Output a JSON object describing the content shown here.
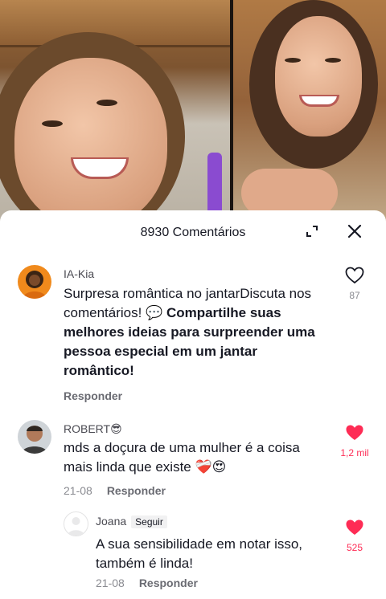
{
  "sheet": {
    "title": "8930 Comentários",
    "expand_icon": "expand-icon",
    "close_icon": "close-icon"
  },
  "comments": [
    {
      "username": "IA-Kia",
      "text_plain": "Surpresa romântica no jantarDiscuta nos comentários! ",
      "emoji": "💬",
      "text_bold": " Compartilhe suas melhores ideias para surpreender uma pessoa especial em um jantar romântico!",
      "reply_label": "Responder",
      "likes": "87",
      "liked": false
    },
    {
      "username": "ROBERT😎",
      "text": "mds a doçura de uma mulher é a coisa mais linda que existe ❤️‍🩹😍",
      "date": "21-08",
      "reply_label": "Responder",
      "likes": "1,2 mil",
      "liked": true
    },
    {
      "username": "Joana",
      "follow_label": "Seguir",
      "text": "A sua sensibilidade em notar isso, também é linda!",
      "date": "21-08",
      "reply_label": "Responder",
      "likes": "525",
      "liked": true
    }
  ],
  "colors": {
    "like_active": "#fe2c55",
    "text_primary": "#161823",
    "text_secondary": "#8a8b91"
  }
}
